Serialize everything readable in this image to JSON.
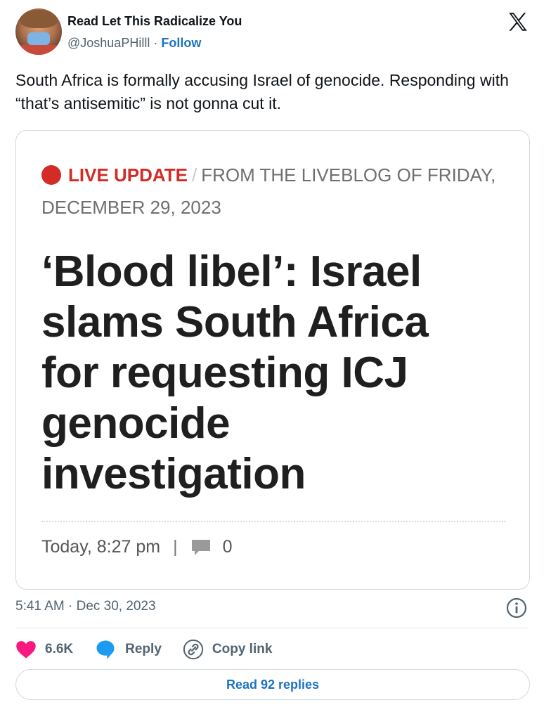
{
  "author": {
    "name": "Read Let This Radicalize You",
    "handle": "@JoshuaPHilll",
    "separator": "·",
    "follow_label": "Follow"
  },
  "tweet": {
    "text": "South Africa is formally accusing Israel of genocide. Responding with “that’s antisemitic” is not gonna cut it.",
    "timestamp": "5:41 AM · Dec 30, 2023"
  },
  "card": {
    "live_label": "LIVE UPDATE",
    "slash": "/",
    "source": "FROM THE LIVEBLOG OF FRIDAY, DECEMBER 29, 2023",
    "headline": "‘Blood libel’: Israel slams South Africa for requesting ICJ genocide investigation",
    "time": "Today, 8:27 pm",
    "sep": "|",
    "comment_count": "0"
  },
  "actions": {
    "likes": "6.6K",
    "reply_label": "Reply",
    "copy_label": "Copy link",
    "read_replies": "Read 92 replies"
  },
  "colors": {
    "like": "#f91880",
    "reply": "#1d9bf0",
    "live": "#d32b26",
    "link": "#1d72c2"
  },
  "icons": [
    "x-logo-icon",
    "live-dot-icon",
    "comment-icon",
    "info-icon",
    "heart-icon",
    "reply-bubble-icon",
    "link-icon"
  ]
}
